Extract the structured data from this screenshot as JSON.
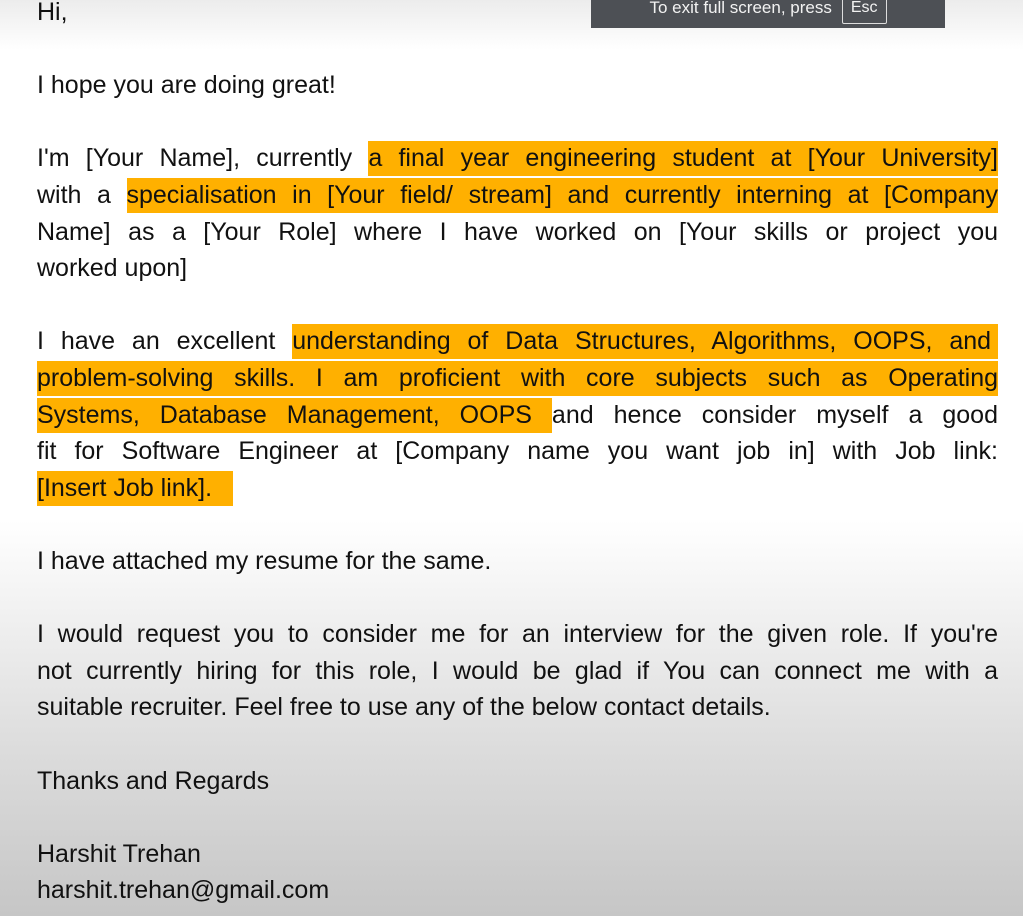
{
  "fullscreen_notice": {
    "text": "To exit full screen, press",
    "key": "Esc"
  },
  "colors": {
    "highlight": "#ffb000",
    "banner": "#4d5055"
  },
  "lines": [
    {
      "row": 0,
      "justify": false,
      "segments": [
        {
          "text": "Hi,",
          "hl": false
        }
      ]
    },
    {
      "row": 2,
      "justify": false,
      "segments": [
        {
          "text": "I hope you are doing great!",
          "hl": false
        }
      ]
    },
    {
      "row": 4,
      "justify": true,
      "segments": [
        {
          "text": "I'm [Your Name], currently ",
          "hl": false
        },
        {
          "text": "a final year engineering student at [Your University]",
          "hl": true
        }
      ]
    },
    {
      "row": 5,
      "justify": true,
      "segments": [
        {
          "text": "with a ",
          "hl": false
        },
        {
          "text": "specialisation in [Your field/ stream] and currently interning at [Company",
          "hl": true
        }
      ]
    },
    {
      "row": 6,
      "justify": true,
      "segments": [
        {
          "text": "Name] as a [Your Role] where I have worked on [Your skills or project you",
          "hl": false
        }
      ]
    },
    {
      "row": 7,
      "justify": false,
      "segments": [
        {
          "text": "worked upon]",
          "hl": false
        }
      ]
    },
    {
      "row": 9,
      "justify": true,
      "segments": [
        {
          "text": "I have an excellent ",
          "hl": false
        },
        {
          "text": "understanding of Data Structures, Algorithms, OOPS, and ",
          "hl": true
        }
      ]
    },
    {
      "row": 10,
      "justify": true,
      "segments": [
        {
          "text": "problem-solving skills. I am proficient with core subjects such as Operating",
          "hl": true
        }
      ]
    },
    {
      "row": 11,
      "justify": true,
      "segments": [
        {
          "text": "Systems, Database Management, OOPS ",
          "hl": true
        },
        {
          "text": "and hence consider myself a good",
          "hl": false
        }
      ]
    },
    {
      "row": 12,
      "justify": true,
      "segments": [
        {
          "text": "fit for Software Engineer at [Company name you want job in] with Job link:",
          "hl": false
        }
      ]
    },
    {
      "row": 13,
      "justify": false,
      "segments": [
        {
          "text": "[Insert Job link].   ",
          "hl": true
        }
      ]
    },
    {
      "row": 15,
      "justify": false,
      "segments": [
        {
          "text": "I have attached my resume for the same.",
          "hl": false
        }
      ]
    },
    {
      "row": 17,
      "justify": true,
      "segments": [
        {
          "text": "I would request you to consider me for an interview for the given role. If you're",
          "hl": false
        }
      ]
    },
    {
      "row": 18,
      "justify": true,
      "segments": [
        {
          "text": "not currently hiring for this role, I would be glad if You can connect me with a",
          "hl": false
        }
      ]
    },
    {
      "row": 19,
      "justify": false,
      "segments": [
        {
          "text": "suitable recruiter. Feel free to use any of the below contact details.",
          "hl": false
        }
      ]
    },
    {
      "row": 21,
      "justify": false,
      "segments": [
        {
          "text": "Thanks and Regards",
          "hl": false
        }
      ]
    },
    {
      "row": 23,
      "justify": false,
      "segments": [
        {
          "text": "Harshit Trehan",
          "hl": false
        }
      ]
    },
    {
      "row": 24,
      "justify": false,
      "segments": [
        {
          "text": "harshit.trehan@gmail.com",
          "hl": false
        }
      ]
    }
  ]
}
